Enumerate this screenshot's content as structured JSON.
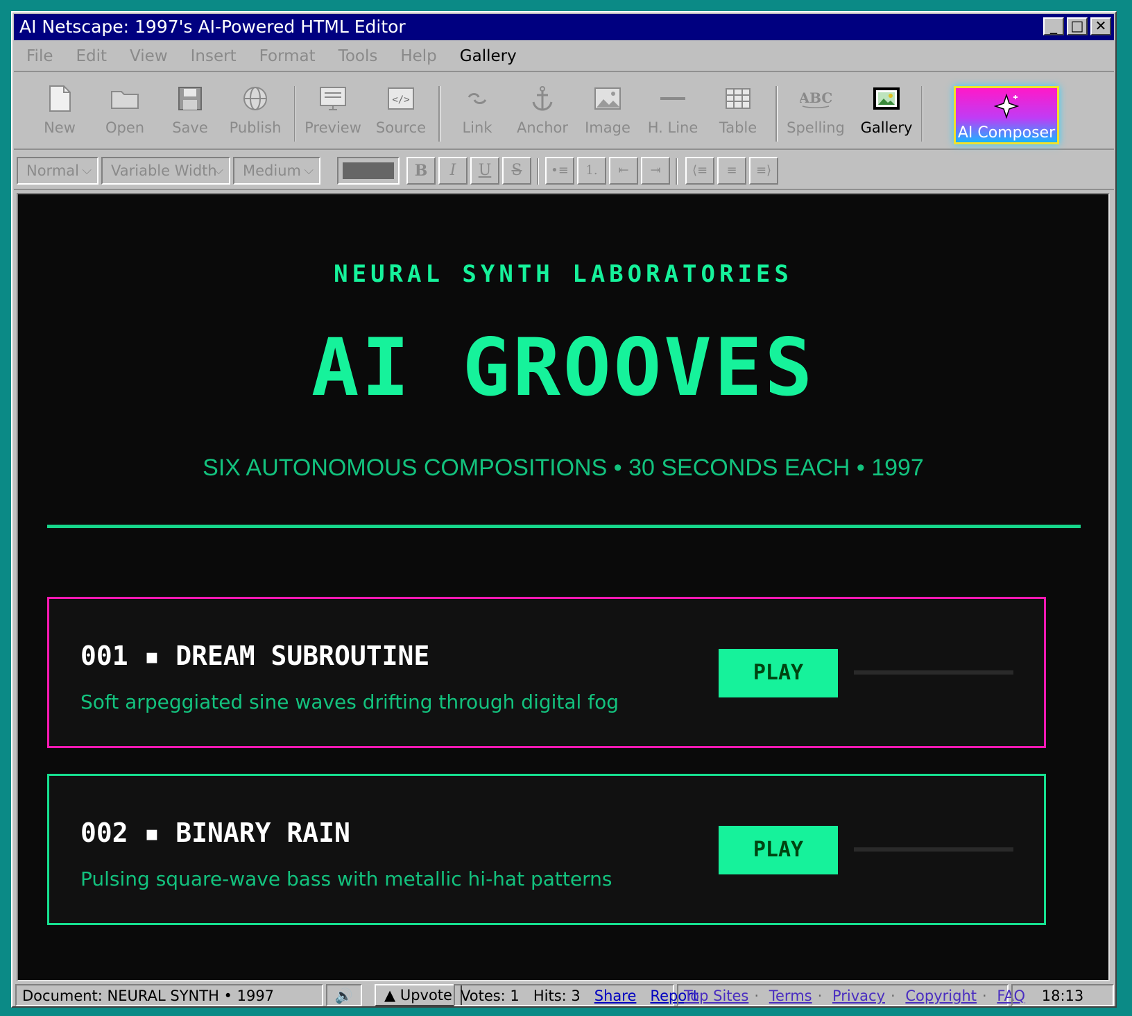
{
  "window": {
    "title": "AI Netscape: 1997's AI-Powered HTML Editor",
    "controls": [
      "_",
      "□",
      "✕"
    ]
  },
  "menu": [
    "File",
    "Edit",
    "View",
    "Insert",
    "Format",
    "Tools",
    "Help",
    "Gallery"
  ],
  "toolbar": {
    "new": "New",
    "open": "Open",
    "save": "Save",
    "publish": "Publish",
    "preview": "Preview",
    "source": "Source",
    "link": "Link",
    "anchor": "Anchor",
    "image": "Image",
    "hline": "H. Line",
    "table": "Table",
    "spelling": "Spelling",
    "gallery": "Gallery",
    "ai_composer": "AI Composer"
  },
  "format": {
    "paragraph": "Normal",
    "font": "Variable Width",
    "size": "Medium",
    "bold": "B",
    "italic": "I",
    "underline": "U",
    "strike": "S",
    "bullets": "•≡",
    "numbers": "1.",
    "outdent": "⇤",
    "indent": "⇥",
    "align_left": "⟨≡",
    "align_center": "≡",
    "align_right": "≡⟩",
    "color": "#666666"
  },
  "page": {
    "lab": "NEURAL SYNTH LABORATORIES",
    "title": "AI GROOVES",
    "subtitle": "SIX AUTONOMOUS COMPOSITIONS • 30 SECONDS EACH • 1997",
    "tracks": [
      {
        "number": "001 ▪ DREAM SUBROUTINE",
        "desc": "Soft arpeggiated sine waves drifting through digital fog",
        "play": "PLAY",
        "progress": 0,
        "border": "#ff19b4"
      },
      {
        "number": "002 ▪ BINARY RAIN",
        "desc": "Pulsing square-wave bass with metallic hi-hat patterns",
        "play": "PLAY",
        "progress": 0,
        "border": "#16e090"
      }
    ]
  },
  "status": {
    "document": "Document: NEURAL SYNTH • 1997",
    "sound": "🔊",
    "upvote": "▲ Upvote",
    "votes": "Votes: 1",
    "hits": "Hits: 3",
    "share": "Share",
    "report": "Report",
    "footer_links": [
      "Top Sites",
      "Terms",
      "Privacy",
      "Copyright",
      "FAQ"
    ],
    "clock": "18:13"
  }
}
